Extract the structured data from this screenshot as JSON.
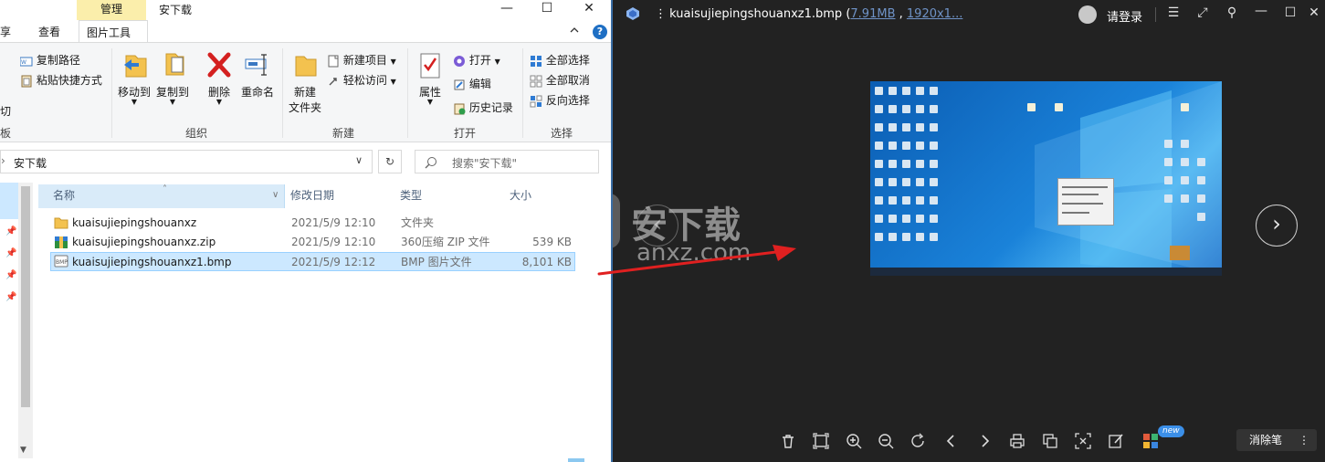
{
  "explorer": {
    "context_tab_label": "管理",
    "window_title": "安下载",
    "tabs": [
      "享",
      "查看",
      "图片工具"
    ],
    "ribbon": {
      "clipboard": {
        "copy_path": "复制路径",
        "paste_shortcut": "粘贴快捷方式",
        "cut": "切",
        "label": "板"
      },
      "organize": {
        "move_to": "移动到",
        "copy_to": "复制到",
        "delete": "删除",
        "rename": "重命名",
        "label": "组织"
      },
      "new": {
        "new_folder_line1": "新建",
        "new_folder_line2": "文件夹",
        "new_item": "新建项目",
        "easy_access": "轻松访问",
        "label": "新建"
      },
      "open": {
        "properties": "属性",
        "open": "打开",
        "edit": "编辑",
        "history": "历史记录",
        "label": "打开"
      },
      "select": {
        "select_all": "全部选择",
        "select_none": "全部取消",
        "invert": "反向选择",
        "label": "选择"
      }
    },
    "address": {
      "path": "安下载",
      "search_placeholder": "搜索\"安下载\""
    },
    "columns": {
      "name": "名称",
      "date": "修改日期",
      "type": "类型",
      "size": "大小"
    },
    "files": [
      {
        "name": "kuaisujiepingshouanxz",
        "date": "2021/5/9 12:10",
        "type": "文件夹",
        "size": "",
        "icon": "folder-icon"
      },
      {
        "name": "kuaisujiepingshouanxz.zip",
        "date": "2021/5/9 12:10",
        "type": "360压缩 ZIP 文件",
        "size": "539 KB",
        "icon": "zip-icon"
      },
      {
        "name": "kuaisujiepingshouanxz1.bmp",
        "date": "2021/5/9 12:12",
        "type": "BMP 图片文件",
        "size": "8,101 KB",
        "icon": "bmp-icon"
      }
    ]
  },
  "viewer": {
    "filename": "kuaisujiepingshouanxz1.bmp",
    "filesize": "7.91MB",
    "resolution": "1920x1...",
    "login": "请登录",
    "eraser": "消除笔",
    "new_badge": "new",
    "watermark_cn": "安下载",
    "watermark_en": "anxz.com",
    "watermark_badge": "安"
  },
  "colors": {
    "accent": "#0078d7",
    "selection": "#cce8ff",
    "viewer_bg": "#222222",
    "context_tab": "#fbeeab",
    "arrow": "#e02020"
  }
}
